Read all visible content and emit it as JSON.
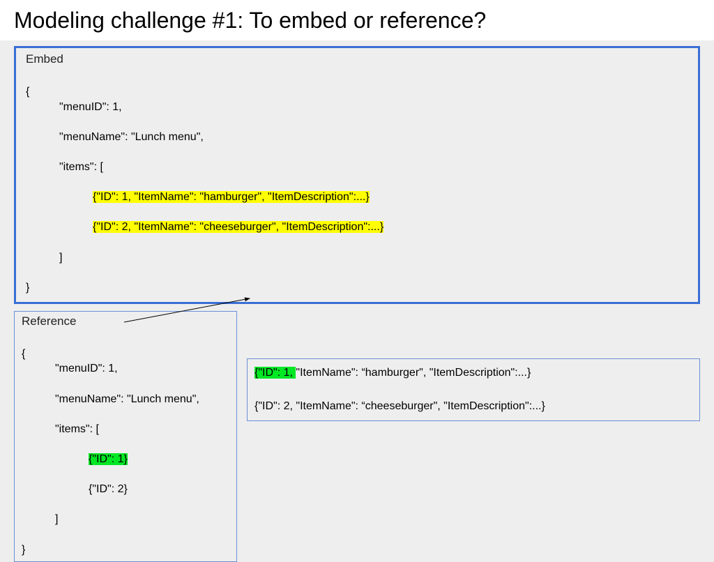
{
  "title": "Modeling challenge #1: To embed or reference?",
  "embed": {
    "label": "Embed",
    "open": "{",
    "l1": "\"menuID\": 1,",
    "l2": "\"menuName\": \"Lunch menu\",",
    "l3": "\"items\": [",
    "item1": "{\"ID\": 1, \"ItemName\": \"hamburger\", \"ItemDescription\":...}",
    "item2": "{\"ID\": 2, \"ItemName\": \"cheeseburger\", \"ItemDescription\":...}",
    "l4": "]",
    "close": "}"
  },
  "reference": {
    "label": "Reference",
    "open": "{",
    "l1": "\"menuID\": 1,",
    "l2": "\"menuName\": \"Lunch menu\",",
    "l3": "\"items\": [",
    "item1": "{\"ID\": 1}",
    "item2": "{\"ID\": 2}",
    "l4": "]",
    "close": "}"
  },
  "items_ext": {
    "row1_hl": "{\"ID\": 1, ",
    "row1_rest": "\"ItemName\": “hamburger\", \"ItemDescription\":...}",
    "row2": "{\"ID\": 2, \"ItemName\": “cheeseburger\", \"ItemDescription\":...}"
  }
}
